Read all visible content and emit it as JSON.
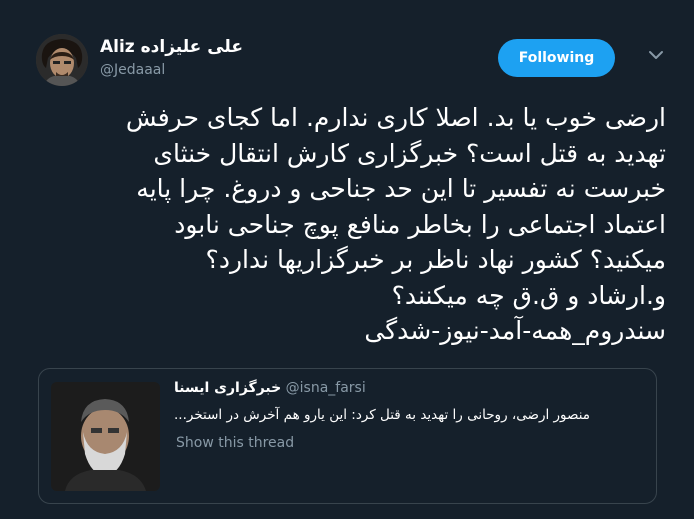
{
  "author": {
    "name_latin": "Aliz",
    "name_persian": "علی علیزاده",
    "handle": "@Jedaaal"
  },
  "follow_button": {
    "label": "Following"
  },
  "tweet": {
    "lines": [
      "ارضی خوب یا بد. اصلا کاری ندارم. اما کجای حرفش",
      "تهدید به قتل است؟ خبرگزاری کارش انتقال خنثای",
      "خبرست نه تفسیر تا این حد جناحی و دروغ. چرا پایه",
      "اعتماد اجتماعی را بخاطر منافع پوچ جناحی نابود",
      "میکنید؟ کشور نهاد ناظر بر خبرگزاریها ندارد؟",
      "و.ارشاد و ق.ق چه میکنند؟",
      "سندروم_همه-آمد-نیوز-شدگی"
    ]
  },
  "quoted_tweet": {
    "name": "خبرگزاری ایسنا",
    "handle": "@isna_farsi",
    "text": "منصور ارضی، روحانی را تهدید به قتل کرد: این یارو هم آخرش در استخر...",
    "show_thread": "Show this thread"
  },
  "colors": {
    "background": "#15202b",
    "accent": "#1da1f2",
    "secondary_text": "#8899a6",
    "border": "#38444d"
  }
}
